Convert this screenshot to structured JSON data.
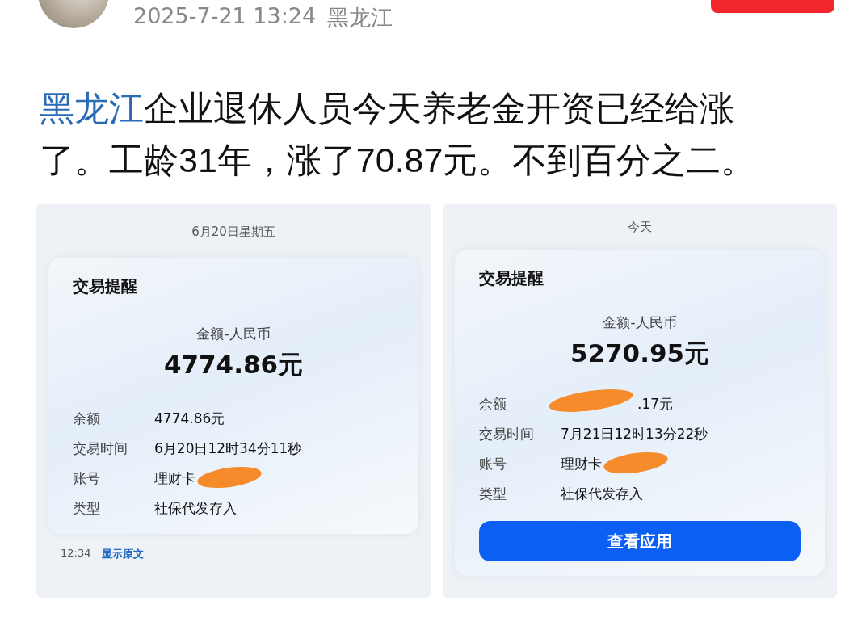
{
  "post": {
    "timestamp": "2025-7-21 13:24",
    "location": "黑龙江",
    "link_text": "黑龙江",
    "text": "企业退休人员今天养老金开资已经给涨了。工龄31年，涨了70.87元。不到百分之二。"
  },
  "screenshots": [
    {
      "date": "6月20日星期五",
      "title": "交易提醒",
      "amount_label": "金额-人民币",
      "amount": "4774.86元",
      "details": [
        {
          "label": "余额",
          "value": "4774.86元",
          "redacted": false
        },
        {
          "label": "交易时间",
          "value": "6月20日12时34分11秒",
          "redacted": false
        },
        {
          "label": "账号",
          "value": "理财卡",
          "redacted": true
        },
        {
          "label": "类型",
          "value": "社保代发存入",
          "redacted": false
        }
      ],
      "footer": {
        "time": "12:34",
        "link": "显示原文"
      }
    },
    {
      "date": "今天",
      "title": "交易提醒",
      "amount_label": "金额-人民币",
      "amount": "5270.95元",
      "details": [
        {
          "label": "余额",
          "value": ".17元",
          "redacted": true
        },
        {
          "label": "交易时间",
          "value": "7月21日12时13分22秒",
          "redacted": false
        },
        {
          "label": "账号",
          "value": "理财卡",
          "redacted": true
        },
        {
          "label": "类型",
          "value": "社保代发存入",
          "redacted": false
        }
      ],
      "button": "查看应用"
    }
  ]
}
